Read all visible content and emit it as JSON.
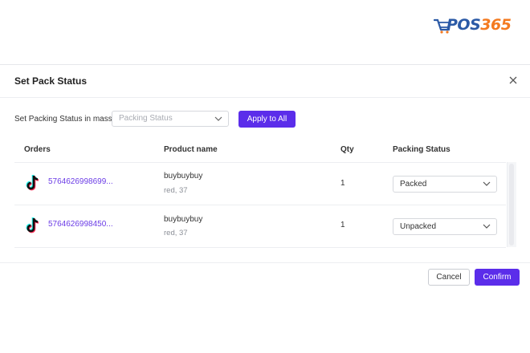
{
  "brand": {
    "logo_part1": "POS",
    "logo_part2": "365"
  },
  "dialog": {
    "title": "Set Pack Status",
    "close_icon": "close-icon",
    "mass_label": "Set Packing Status in mass :",
    "mass_select_placeholder": "Packing Status",
    "apply_label": "Apply to All",
    "columns": {
      "orders": "Orders",
      "product": "Product name",
      "qty": "Qty",
      "status": "Packing Status"
    },
    "rows": [
      {
        "channel_icon": "tiktok-icon",
        "order_id": "5764626998699...",
        "product_name": "buybuybuy",
        "variant": "red, 37",
        "qty": "1",
        "status": "Packed"
      },
      {
        "channel_icon": "tiktok-icon",
        "order_id": "5764626998450...",
        "product_name": "buybuybuy",
        "variant": "red, 37",
        "qty": "1",
        "status": "Unpacked"
      }
    ],
    "cancel_label": "Cancel",
    "confirm_label": "Confirm"
  },
  "colors": {
    "accent": "#5b2dea",
    "link": "#6b3ce6",
    "logo_blue": "#2b5aa6",
    "logo_orange": "#f47a20"
  }
}
